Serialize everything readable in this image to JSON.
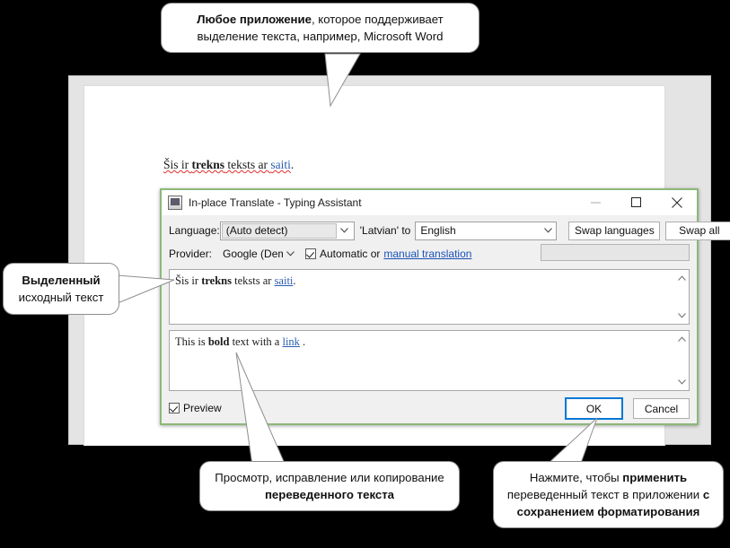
{
  "word": {
    "document_text": {
      "part1": "Šis ir ",
      "bold": "trekns",
      "part2": " teksts ar ",
      "link": "saiti",
      "part3": "."
    }
  },
  "dialog": {
    "title": "In-place Translate - Typing Assistant",
    "icon": "app-icon",
    "window_controls": {
      "minimize": "minimize-icon",
      "maximize": "maximize-icon",
      "close": "close-icon"
    },
    "language_row": {
      "label": "Language:",
      "source_value": "(Auto detect)",
      "to_label": "'Latvian' to",
      "target_value": "English",
      "swap_languages": "Swap languages",
      "swap_all": "Swap all"
    },
    "provider_row": {
      "label": "Provider:",
      "provider_value": "Google (Demo)",
      "automatic_label": "Automatic or",
      "manual_link": "manual translation",
      "automatic_checked": true
    },
    "source_box": {
      "part1": "Šis ir ",
      "bold": "trekns",
      "part2": " teksts ar ",
      "link": "saiti",
      "part3": "."
    },
    "target_box": {
      "part1": "This is ",
      "bold": "bold",
      "part2": " text with a ",
      "link": "link",
      "part3": " ."
    },
    "footer": {
      "preview_label": "Preview",
      "preview_checked": true,
      "ok_label": "OK",
      "cancel_label": "Cancel"
    }
  },
  "callouts": {
    "app": {
      "bold": "Любое приложение",
      "rest": ", которое поддерживает выделение текста, например, Microsoft Word"
    },
    "source": {
      "bold": "Выделенный",
      "rest": "исходный текст"
    },
    "middle": {
      "lead": "Просмотр, исправление или копирование ",
      "bold": "переведенного текста"
    },
    "apply": {
      "lead": "Нажмите, чтобы ",
      "bold1": "применить",
      "mid": " переведенный текст в приложении ",
      "bold2": "с сохранением форматирования"
    }
  },
  "colors": {
    "accent_blue": "#0078d7",
    "link_blue": "#1a52b8",
    "dialog_border_green": "#8cb878",
    "spellcheck_red": "#e03030"
  }
}
